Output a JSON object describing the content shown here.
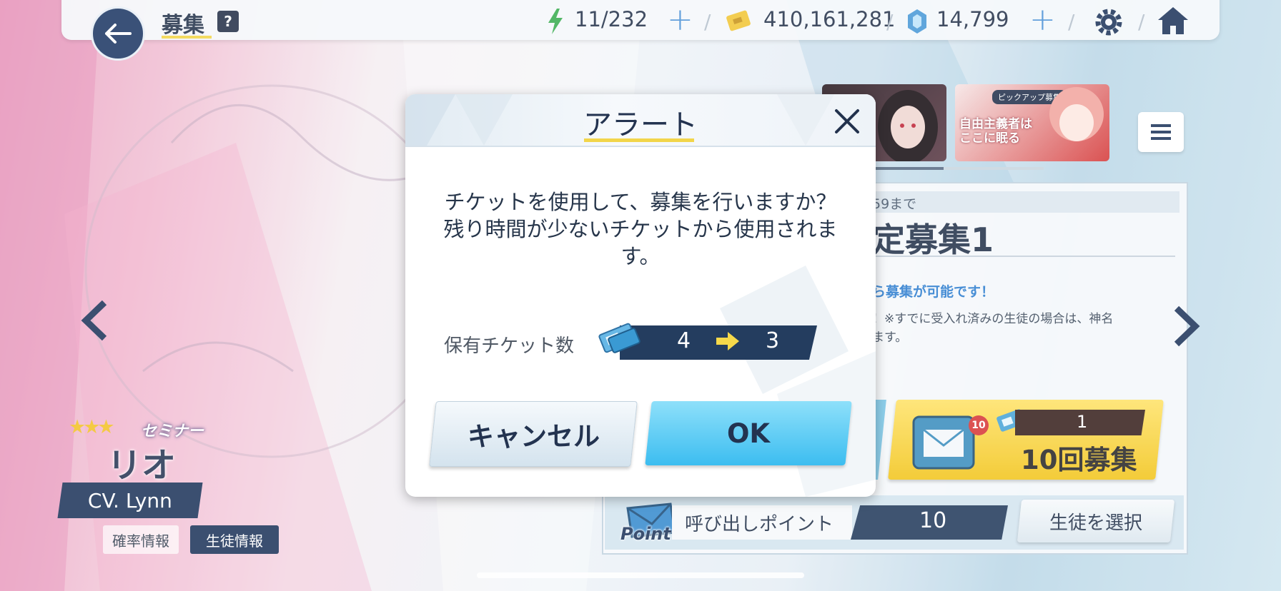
{
  "header": {
    "title": "募集",
    "help_label": "?",
    "ap": "11/232",
    "credits": "410,161,281",
    "pyroxene": "14,799",
    "plus": "+"
  },
  "banner": {
    "pickup_label": "ピックアップ募集",
    "pickup_title": "自由主義者はここに眠る"
  },
  "panel": {
    "period": "59まで",
    "name": "定募集1",
    "notice": "ら募集が可能です！",
    "desc_line1": "！※すでに受入れ済みの生徒の場合は、神名",
    "desc_line2": "ます。",
    "ten_pull_badge": "10",
    "ten_pull_ticket_count": "1",
    "ten_pull_label": "10回募集",
    "point_logo": "Point",
    "point_label": "呼び出しポイント",
    "point_value": "10",
    "select_student": "生徒を選択"
  },
  "character": {
    "name": "リオ",
    "role": "セミナー",
    "cv": "CV. Lynn",
    "rate_info": "確率情報",
    "student_info": "生徒情報"
  },
  "dialog": {
    "title": "アラート",
    "message_line1": "チケットを使用して、募集を行いますか？",
    "message_line2": "残り時間が少ないチケットから使用されま",
    "message_line3": "す。",
    "ticket_label": "保有チケット数",
    "ticket_from": "4",
    "ticket_to": "3",
    "cancel_label": "キャンセル",
    "ok_label": "OK"
  },
  "colors": {
    "navy": "#243d5f",
    "accent_yellow": "#f2d54a",
    "ok_blue": "#3cbdf0",
    "ten_pull_gold": "#f5d43a"
  }
}
